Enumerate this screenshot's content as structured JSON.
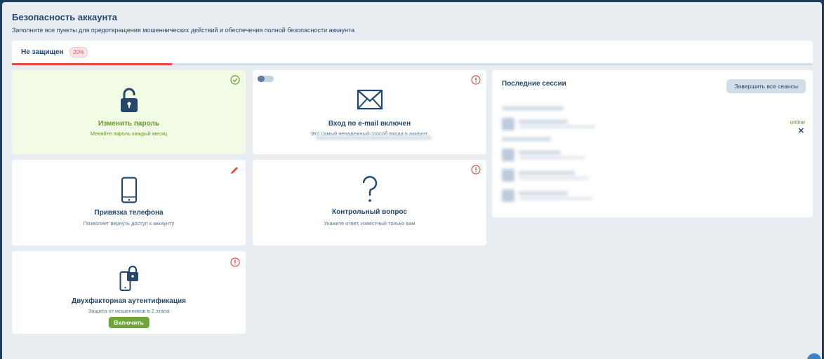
{
  "header": {
    "title": "Безопасность аккаунта",
    "subtitle": "Заполните все пункты для предотвращения мошеннических действий и обеспечения полной безопасности аккаунта"
  },
  "status": {
    "label": "Не защищен",
    "percent_label": "20%",
    "progress": 0.2,
    "color": "#e84a4a"
  },
  "cards": {
    "password": {
      "title": "Изменить пароль",
      "description": "Меняйте пароль каждый месяц",
      "icon": "lock-open-icon",
      "status_icon": "check-circle-icon",
      "completed": true
    },
    "email_login": {
      "title": "Вход по e-mail включен",
      "description": "Это самый ненадежный способ входа в аккаунт.",
      "icon": "envelope-icon",
      "status_icon": "warning-circle-icon",
      "toggle_on": false
    },
    "phone": {
      "title": "Привязка телефона",
      "description": "Позволяет вернуть доступ к аккаунту",
      "icon": "phone-icon",
      "status_icon": "pencil-icon"
    },
    "security_question": {
      "title": "Контрольный вопрос",
      "description": "Укажите ответ, известный только вам",
      "icon": "question-mark-icon",
      "status_icon": "warning-circle-icon"
    },
    "two_factor": {
      "title": "Двухфакторная аутентификация",
      "description": "Защита от мошенников в 2 этапа",
      "button_label": "Включить",
      "icon": "phone-lock-icon",
      "status_icon": "warning-circle-icon"
    }
  },
  "sessions": {
    "title": "Последние сессии",
    "end_all_label": "Завершить все сеансы",
    "current_status": "online",
    "close_glyph": "✕"
  },
  "colors": {
    "primary": "#24476b",
    "success": "#6a9a2a",
    "danger": "#e84a4a",
    "background": "#e8edf2"
  }
}
